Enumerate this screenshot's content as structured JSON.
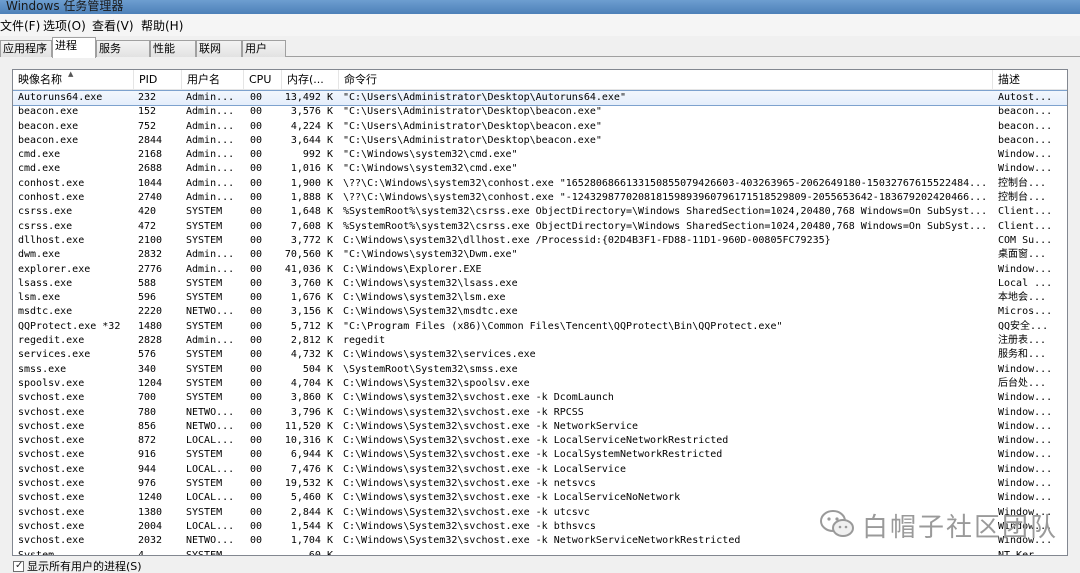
{
  "window": {
    "title": "Windows 任务管理器"
  },
  "menu": {
    "items": [
      "文件(F)",
      "选项(O)",
      "查看(V)",
      "帮助(H)"
    ]
  },
  "tabs": [
    "应用程序",
    "进程",
    "服务",
    "性能",
    "联网",
    "用户"
  ],
  "active_tab": "进程",
  "columns": {
    "name": "映像名称",
    "pid": "PID",
    "user": "用户名",
    "cpu": "CPU",
    "mem": "内存(...",
    "cmd": "命令行",
    "desc": "描述"
  },
  "processes": [
    {
      "name": "Autoruns64.exe",
      "pid": "232",
      "user": "Admin...",
      "cpu": "00",
      "mem": "13,492 K",
      "cmd": "\"C:\\Users\\Administrator\\Desktop\\Autoruns64.exe\"",
      "desc": "Autost..."
    },
    {
      "name": "beacon.exe",
      "pid": "152",
      "user": "Admin...",
      "cpu": "00",
      "mem": "3,576 K",
      "cmd": "\"C:\\Users\\Administrator\\Desktop\\beacon.exe\"",
      "desc": "beacon..."
    },
    {
      "name": "beacon.exe",
      "pid": "752",
      "user": "Admin...",
      "cpu": "00",
      "mem": "4,224 K",
      "cmd": "\"C:\\Users\\Administrator\\Desktop\\beacon.exe\"",
      "desc": "beacon..."
    },
    {
      "name": "beacon.exe",
      "pid": "2844",
      "user": "Admin...",
      "cpu": "00",
      "mem": "3,644 K",
      "cmd": "\"C:\\Users\\Administrator\\Desktop\\beacon.exe\"",
      "desc": "beacon..."
    },
    {
      "name": "cmd.exe",
      "pid": "2168",
      "user": "Admin...",
      "cpu": "00",
      "mem": "992 K",
      "cmd": "\"C:\\Windows\\system32\\cmd.exe\"",
      "desc": "Window..."
    },
    {
      "name": "cmd.exe",
      "pid": "2688",
      "user": "Admin...",
      "cpu": "00",
      "mem": "1,016 K",
      "cmd": "\"C:\\Windows\\system32\\cmd.exe\"",
      "desc": "Window..."
    },
    {
      "name": "conhost.exe",
      "pid": "1044",
      "user": "Admin...",
      "cpu": "00",
      "mem": "1,900 K",
      "cmd": "\\??\\C:\\Windows\\system32\\conhost.exe \"165280686613315085507942660­3-403263965-2062649180-15032767615522484...",
      "desc": "控制台..."
    },
    {
      "name": "conhost.exe",
      "pid": "2740",
      "user": "Admin...",
      "cpu": "00",
      "mem": "1,888 K",
      "cmd": "\\??\\C:\\Windows\\system32\\conhost.exe \"-12432987702081815989396079617151852980­9-2055653642-183679202420466...",
      "desc": "控制台..."
    },
    {
      "name": "csrss.exe",
      "pid": "420",
      "user": "SYSTEM",
      "cpu": "00",
      "mem": "1,648 K",
      "cmd": "%SystemRoot%\\system32\\csrss.exe ObjectDirectory=\\Windows SharedSection=1024,20480,768 Windows=On SubSyst...",
      "desc": "Client..."
    },
    {
      "name": "csrss.exe",
      "pid": "472",
      "user": "SYSTEM",
      "cpu": "00",
      "mem": "7,608 K",
      "cmd": "%SystemRoot%\\system32\\csrss.exe ObjectDirectory=\\Windows SharedSection=1024,20480,768 Windows=On SubSyst...",
      "desc": "Client..."
    },
    {
      "name": "dllhost.exe",
      "pid": "2100",
      "user": "SYSTEM",
      "cpu": "00",
      "mem": "3,772 K",
      "cmd": "C:\\Windows\\system32\\dllhost.exe /Processid:{02D4B3F1-FD88-11D1-960D-00805FC79235}",
      "desc": "COM Su..."
    },
    {
      "name": "dwm.exe",
      "pid": "2832",
      "user": "Admin...",
      "cpu": "00",
      "mem": "70,560 K",
      "cmd": "\"C:\\Windows\\system32\\Dwm.exe\"",
      "desc": "桌面窗..."
    },
    {
      "name": "explorer.exe",
      "pid": "2776",
      "user": "Admin...",
      "cpu": "00",
      "mem": "41,036 K",
      "cmd": "C:\\Windows\\Explorer.EXE",
      "desc": "Window..."
    },
    {
      "name": "lsass.exe",
      "pid": "588",
      "user": "SYSTEM",
      "cpu": "00",
      "mem": "3,760 K",
      "cmd": "C:\\Windows\\system32\\lsass.exe",
      "desc": "Local ..."
    },
    {
      "name": "lsm.exe",
      "pid": "596",
      "user": "SYSTEM",
      "cpu": "00",
      "mem": "1,676 K",
      "cmd": "C:\\Windows\\system32\\lsm.exe",
      "desc": "本地会..."
    },
    {
      "name": "msdtc.exe",
      "pid": "2220",
      "user": "NETWO...",
      "cpu": "00",
      "mem": "3,156 K",
      "cmd": "C:\\Windows\\System32\\msdtc.exe",
      "desc": "Micros..."
    },
    {
      "name": "QQProtect.exe *32",
      "pid": "1480",
      "user": "SYSTEM",
      "cpu": "00",
      "mem": "5,712 K",
      "cmd": "\"C:\\Program Files (x86)\\Common Files\\Tencent\\QQProtect\\Bin\\QQProtect.exe\"",
      "desc": "QQ安全..."
    },
    {
      "name": "regedit.exe",
      "pid": "2828",
      "user": "Admin...",
      "cpu": "00",
      "mem": "2,812 K",
      "cmd": "regedit",
      "desc": "注册表..."
    },
    {
      "name": "services.exe",
      "pid": "576",
      "user": "SYSTEM",
      "cpu": "00",
      "mem": "4,732 K",
      "cmd": "C:\\Windows\\system32\\services.exe",
      "desc": "服务和..."
    },
    {
      "name": "smss.exe",
      "pid": "340",
      "user": "SYSTEM",
      "cpu": "00",
      "mem": "504 K",
      "cmd": "\\SystemRoot\\System32\\smss.exe",
      "desc": "Window..."
    },
    {
      "name": "spoolsv.exe",
      "pid": "1204",
      "user": "SYSTEM",
      "cpu": "00",
      "mem": "4,704 K",
      "cmd": "C:\\Windows\\System32\\spoolsv.exe",
      "desc": "后台处..."
    },
    {
      "name": "svchost.exe",
      "pid": "700",
      "user": "SYSTEM",
      "cpu": "00",
      "mem": "3,860 K",
      "cmd": "C:\\Windows\\system32\\svchost.exe -k DcomLaunch",
      "desc": "Window..."
    },
    {
      "name": "svchost.exe",
      "pid": "780",
      "user": "NETWO...",
      "cpu": "00",
      "mem": "3,796 K",
      "cmd": "C:\\Windows\\system32\\svchost.exe -k RPCSS",
      "desc": "Window..."
    },
    {
      "name": "svchost.exe",
      "pid": "856",
      "user": "NETWO...",
      "cpu": "00",
      "mem": "11,520 K",
      "cmd": "C:\\Windows\\System32\\svchost.exe -k NetworkService",
      "desc": "Window..."
    },
    {
      "name": "svchost.exe",
      "pid": "872",
      "user": "LOCAL...",
      "cpu": "00",
      "mem": "10,316 K",
      "cmd": "C:\\Windows\\System32\\svchost.exe -k LocalServiceNetworkRestricted",
      "desc": "Window..."
    },
    {
      "name": "svchost.exe",
      "pid": "916",
      "user": "SYSTEM",
      "cpu": "00",
      "mem": "6,944 K",
      "cmd": "C:\\Windows\\System32\\svchost.exe -k LocalSystemNetworkRestricted",
      "desc": "Window..."
    },
    {
      "name": "svchost.exe",
      "pid": "944",
      "user": "LOCAL...",
      "cpu": "00",
      "mem": "7,476 K",
      "cmd": "C:\\Windows\\system32\\svchost.exe -k LocalService",
      "desc": "Window..."
    },
    {
      "name": "svchost.exe",
      "pid": "976",
      "user": "SYSTEM",
      "cpu": "00",
      "mem": "19,532 K",
      "cmd": "C:\\Windows\\system32\\svchost.exe -k netsvcs",
      "desc": "Window..."
    },
    {
      "name": "svchost.exe",
      "pid": "1240",
      "user": "LOCAL...",
      "cpu": "00",
      "mem": "5,460 K",
      "cmd": "C:\\Windows\\system32\\svchost.exe -k LocalServiceNoNetwork",
      "desc": "Window..."
    },
    {
      "name": "svchost.exe",
      "pid": "1380",
      "user": "SYSTEM",
      "cpu": "00",
      "mem": "2,844 K",
      "cmd": "C:\\Windows\\System32\\svchost.exe -k utcsvc",
      "desc": "Window..."
    },
    {
      "name": "svchost.exe",
      "pid": "2004",
      "user": "LOCAL...",
      "cpu": "00",
      "mem": "1,544 K",
      "cmd": "C:\\Windows\\System32\\svchost.exe -k bthsvcs",
      "desc": "Window..."
    },
    {
      "name": "svchost.exe",
      "pid": "2032",
      "user": "NETWO...",
      "cpu": "00",
      "mem": "1,704 K",
      "cmd": "C:\\Windows\\System32\\svchost.exe -k NetworkServiceNetworkRestricted",
      "desc": "Window..."
    },
    {
      "name": "System",
      "pid": "4",
      "user": "SYSTEM",
      "cpu": "",
      "mem": "60 K",
      "cmd": "",
      "desc": "NT Ker..."
    }
  ],
  "show_all_label": "显示所有用户的进程(S)",
  "show_all_checked": true,
  "watermark": {
    "text": "白帽子社区团队",
    "icon": "wechat-icon"
  }
}
